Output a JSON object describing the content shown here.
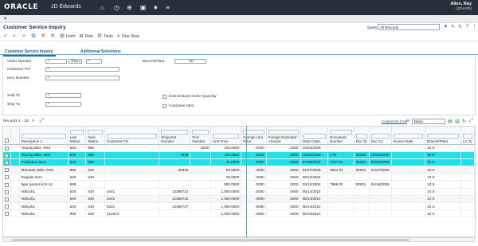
{
  "header": {
    "logo": "ORACLE",
    "app_name": "JD Edwards",
    "user_name": "Allen, Ray",
    "user_id": "(JDVAYB)"
  },
  "icons": {
    "home": "home-icon",
    "recent": "recent-icon",
    "open_app": "open-app-icon",
    "tasks": "tasks-icon",
    "favorites": "favorites-icon",
    "menu": "menu-icon"
  },
  "page": {
    "title": "Customer Service Inquiry",
    "query_label": "Query:",
    "query_value": "All Records"
  },
  "toolbar": {
    "form_label": "Form",
    "row_label": "Row",
    "tools_label": "Tools",
    "oneview_label": "One View"
  },
  "tabs": [
    {
      "label": "Customer Service Inquiry"
    },
    {
      "label": "Additional Selections"
    }
  ],
  "form": {
    "order_number_label": "Order Number",
    "order_number_value": "*",
    "order_type_value": "SO",
    "order_company_value": "*",
    "branch_plant_label": "Branch/Plant",
    "branch_plant_value": "10",
    "customer_po_label": "Customer PO",
    "customer_po_value": "*",
    "item_number_label": "Item Number",
    "item_number_value": "*",
    "sold_to_label": "Sold To",
    "sold_to_value": "*",
    "ship_to_label": "Ship To",
    "ship_to_value": "*",
    "extend_back_order_label": "Extend Back Order Quantity",
    "customer_item_label": "Customer Item"
  },
  "grid": {
    "records_label": "Records 1 - 10",
    "customize_label": "Customize Grid",
    "view_value": "Basic",
    "columns": [
      "Description 1",
      "Last Status",
      "Next Status",
      "Customer PO",
      "Shipment Number",
      "Pick Number",
      "Unit Price",
      "Foreign Unit Price",
      "Foreign Extended Amount",
      "Order Date",
      "Document Number",
      "Doc Ty",
      "Doc Co",
      "Invoice Date",
      "Branch/Plant",
      "Ln Ty"
    ],
    "rows": [
      [
        "Touring Bike, Red",
        "540",
        "560",
        "",
        "",
        "4636",
        "100.0000",
        ".0000",
        ".0000",
        "10/04/2009",
        "",
        "",
        "",
        "",
        "10 S",
        ""
      ],
      [
        "Touring Bike, Red",
        "620",
        "999",
        "",
        "7938",
        "",
        "100.0000",
        ".0000",
        ".0000",
        "10/04/2009",
        "2 RI",
        "00200",
        "10/04/2009",
        "",
        "10 S",
        ""
      ],
      [
        "Protection Item",
        "620",
        "999",
        "",
        "",
        "",
        "25.0000",
        ".0000",
        ".0000",
        "07/09/2004",
        "2727 RI",
        "00001",
        "06/06/2005",
        "",
        "10 S",
        ""
      ],
      [
        "Mountain Bike, Red",
        "580",
        "620",
        "",
        "50625",
        "",
        "50.0000",
        ".0000",
        ".0000",
        "01/27/2006",
        "6941 RI",
        "00001",
        "01/27/2006",
        "",
        "10 S",
        ""
      ],
      [
        "Regular Item",
        "520",
        "540",
        "",
        "",
        "",
        "25.0000",
        ".0000",
        ".0000",
        "09/12/2004",
        "",
        "",
        "",
        "",
        "10 S",
        ""
      ],
      [
        "tiger parent kit 6.12",
        "999",
        "",
        "",
        "",
        "",
        "500.0000",
        ".0000",
        ".0000",
        "09/14/2004",
        "7986 RI",
        "00001",
        "04/19/2005",
        "",
        "10 S",
        ""
      ],
      [
        "NStock1",
        "520",
        "540",
        "3441",
        "12366722",
        "",
        "1,000.0000",
        ".0000",
        ".0000",
        "05/14/2014",
        "",
        "",
        "",
        "",
        "10 S",
        ""
      ],
      [
        "NStock1",
        "520",
        "540",
        "3441",
        "12366722",
        "",
        "1,000.0000",
        ".0000",
        ".0000",
        "05/14/2014",
        "",
        "",
        "",
        "",
        "10 S",
        ""
      ],
      [
        "NStock1",
        "520",
        "540",
        "6321",
        "12366727",
        "",
        "1,000.0000",
        ".0000",
        ".0000",
        "05/14/2014",
        "",
        "",
        "",
        "",
        "10 S",
        ""
      ],
      [
        "NStock1",
        "900",
        "540",
        "214214",
        "",
        "",
        "1,000.0000",
        ".0000",
        ".0000",
        "05/14/2014",
        "",
        "",
        "",
        "",
        "10 S",
        ""
      ]
    ]
  }
}
